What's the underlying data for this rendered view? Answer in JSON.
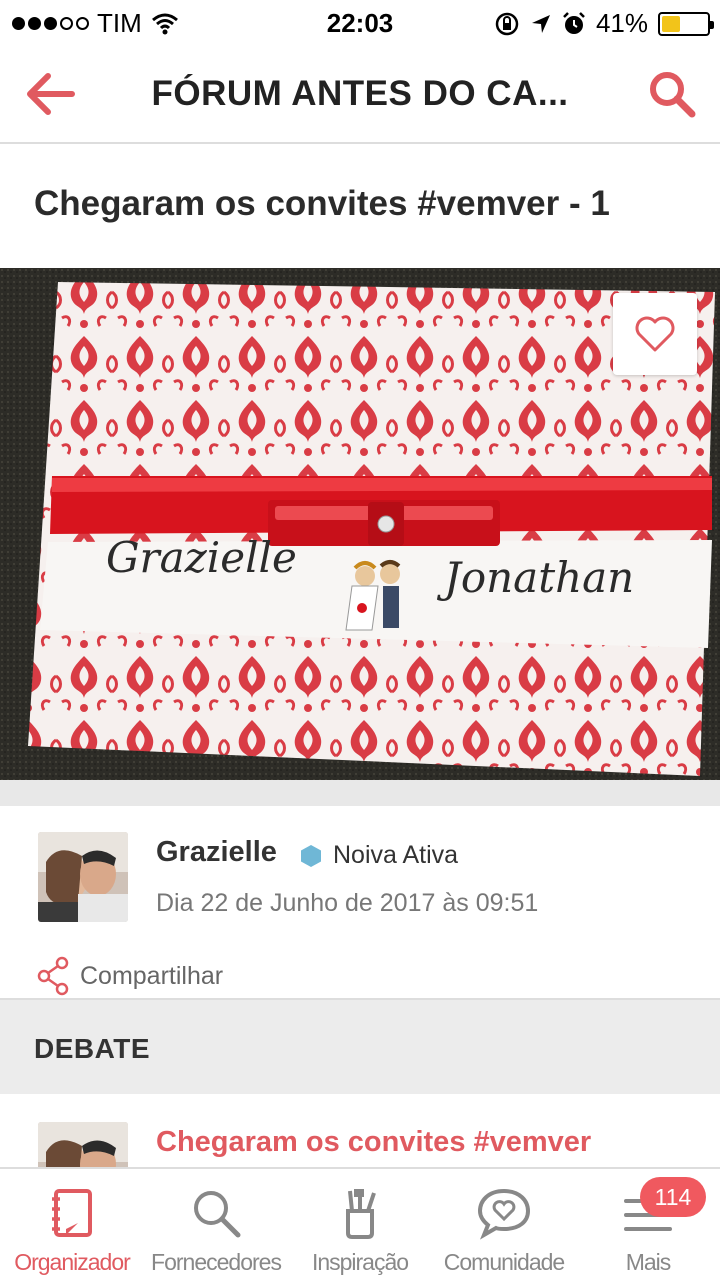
{
  "status_bar": {
    "carrier": "TIM",
    "time": "22:03",
    "battery_percent": "41%",
    "battery_level": 0.41,
    "icons": [
      "signal-dots-icon",
      "wifi-icon",
      "rotation-lock-icon",
      "location-arrow-icon",
      "alarm-icon",
      "battery-icon"
    ]
  },
  "nav": {
    "title": "FÓRUM ANTES DO CA...",
    "back_icon": "arrow-left-icon",
    "search_icon": "search-icon"
  },
  "post": {
    "title": "Chegaram os convites #vemver - 1",
    "invitation_names": [
      "Grazielle",
      "Jonathan"
    ],
    "favorite_icon": "heart-outline-icon"
  },
  "author": {
    "name": "Grazielle",
    "badge": "Noiva Ativa",
    "date": "Dia 22 de Junho de 2017 às 09:51"
  },
  "share": {
    "label": "Compartilhar",
    "icon": "share-icon"
  },
  "section": {
    "title": "DEBATE"
  },
  "reply": {
    "title": "Chegaram os convites #vemver"
  },
  "tabs": [
    {
      "label": "Organizador",
      "icon": "notebook-icon",
      "active": true
    },
    {
      "label": "Fornecedores",
      "icon": "search-icon",
      "active": false
    },
    {
      "label": "Inspiração",
      "icon": "brush-cup-icon",
      "active": false
    },
    {
      "label": "Comunidade",
      "icon": "chat-heart-icon",
      "active": false
    },
    {
      "label": "Mais",
      "icon": "menu-icon",
      "active": false,
      "badge": "114"
    }
  ],
  "colors": {
    "accent": "#e05a60",
    "badge": "#6fb7d6",
    "tab_inactive": "#888888"
  }
}
